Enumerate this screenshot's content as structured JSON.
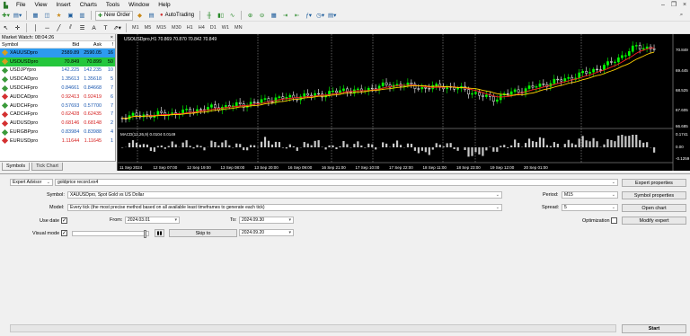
{
  "menu": {
    "items": [
      "File",
      "View",
      "Insert",
      "Charts",
      "Tools",
      "Window",
      "Help"
    ]
  },
  "toolbar": {
    "new_order": "New Order",
    "autotrading": "AutoTrading",
    "timeframes": [
      "M1",
      "M5",
      "M15",
      "M30",
      "H1",
      "H4",
      "D1",
      "W1",
      "MN"
    ]
  },
  "market_watch": {
    "title": "Market Watch: 08:04:26",
    "headers": {
      "symbol": "Symbol",
      "bid": "Bid",
      "ask": "Ask",
      "spread": "!"
    },
    "rows": [
      {
        "symbol": "XAUUSDpro",
        "bid": "2589.89",
        "ask": "2590.05",
        "spread": "16",
        "color": "#d4a020",
        "hl": "#2d9bf0"
      },
      {
        "symbol": "USOUSDpro",
        "bid": "70.849",
        "ask": "70.899",
        "spread": "50",
        "color": "#d4a020",
        "hl": "#24c63c"
      },
      {
        "symbol": "USDJPYpro",
        "bid": "142.225",
        "ask": "142.235",
        "spread": "10",
        "color": "#3a9a3a",
        "hl": ""
      },
      {
        "symbol": "USDCADpro",
        "bid": "1.35613",
        "ask": "1.35618",
        "spread": "5",
        "color": "#3a9a3a",
        "hl": ""
      },
      {
        "symbol": "USDCHFpro",
        "bid": "0.84661",
        "ask": "0.84668",
        "spread": "7",
        "color": "#3a9a3a",
        "hl": ""
      },
      {
        "symbol": "AUDCADpro",
        "bid": "0.92413",
        "ask": "0.92419",
        "spread": "6",
        "color": "#d43030",
        "hl": ""
      },
      {
        "symbol": "AUDCHFpro",
        "bid": "0.57693",
        "ask": "0.57700",
        "spread": "7",
        "color": "#3a9a3a",
        "hl": ""
      },
      {
        "symbol": "CADCHFpro",
        "bid": "0.62428",
        "ask": "0.62435",
        "spread": "7",
        "color": "#d43030",
        "hl": ""
      },
      {
        "symbol": "AUDUSDpro",
        "bid": "0.68146",
        "ask": "0.68148",
        "spread": "2",
        "color": "#d43030",
        "hl": ""
      },
      {
        "symbol": "EURGBPpro",
        "bid": "0.83984",
        "ask": "0.83988",
        "spread": "4",
        "color": "#3a9a3a",
        "hl": ""
      },
      {
        "symbol": "EURUSDpro",
        "bid": "1.11644",
        "ask": "1.11645",
        "spread": "1",
        "color": "#d43030",
        "hl": ""
      }
    ],
    "tabs": [
      "Symbols",
      "Tick Chart"
    ]
  },
  "chart": {
    "header": "USOUSDpro,H1  70.869 70.870 70.842 70.849",
    "macd_label": "MACD(12,26,9) 0.0104 0.0149",
    "price_ticks": [
      "70.849",
      "69.445",
      "68.525",
      "67.605",
      "66.685"
    ],
    "macd_ticks": [
      "0.1741",
      "0.00",
      "-0.1259"
    ],
    "time_ticks": [
      "11 Sep 2024",
      "12 Sep 07:00",
      "12 Sep 19:00",
      "13 Sep 08:00",
      "13 Sep 20:00",
      "16 Sep 09:00",
      "16 Sep 21:00",
      "17 Sep 10:00",
      "17 Sep 22:00",
      "18 Sep 11:00",
      "18 Sep 23:00",
      "19 Sep 12:00",
      "20 Sep 01:00"
    ],
    "colors": {
      "bull": "#00ff00",
      "bear": "#ffffff",
      "ma1": "#ff2020",
      "ma2": "#ffd000",
      "macd": "#c8c8c8"
    }
  },
  "tester": {
    "type": "Expert Advisor",
    "ea": "goldprice record.ex4",
    "symbol_label": "Symbol:",
    "symbol": "XAUUSDpro, Spot Gold vs US Dollar",
    "model_label": "Model:",
    "model": "Every tick (the most precise method based on all available least timeframes to generate each tick)",
    "use_date_label": "Use date",
    "from_label": "From:",
    "from": "2024.03.01",
    "to_label": "To:",
    "to": "2024.09.30",
    "visual_label": "Visual mode",
    "skip_button": "Skip to",
    "skip_date": "2024.09.20",
    "period_label": "Period:",
    "period": "M15",
    "spread_label": "Spread:",
    "spread": "5",
    "optimization_label": "Optimization",
    "buttons": {
      "expert_properties": "Expert properties",
      "symbol_properties": "Symbol properties",
      "open_chart": "Open chart",
      "modify_expert": "Modify expert",
      "start": "Start"
    }
  }
}
